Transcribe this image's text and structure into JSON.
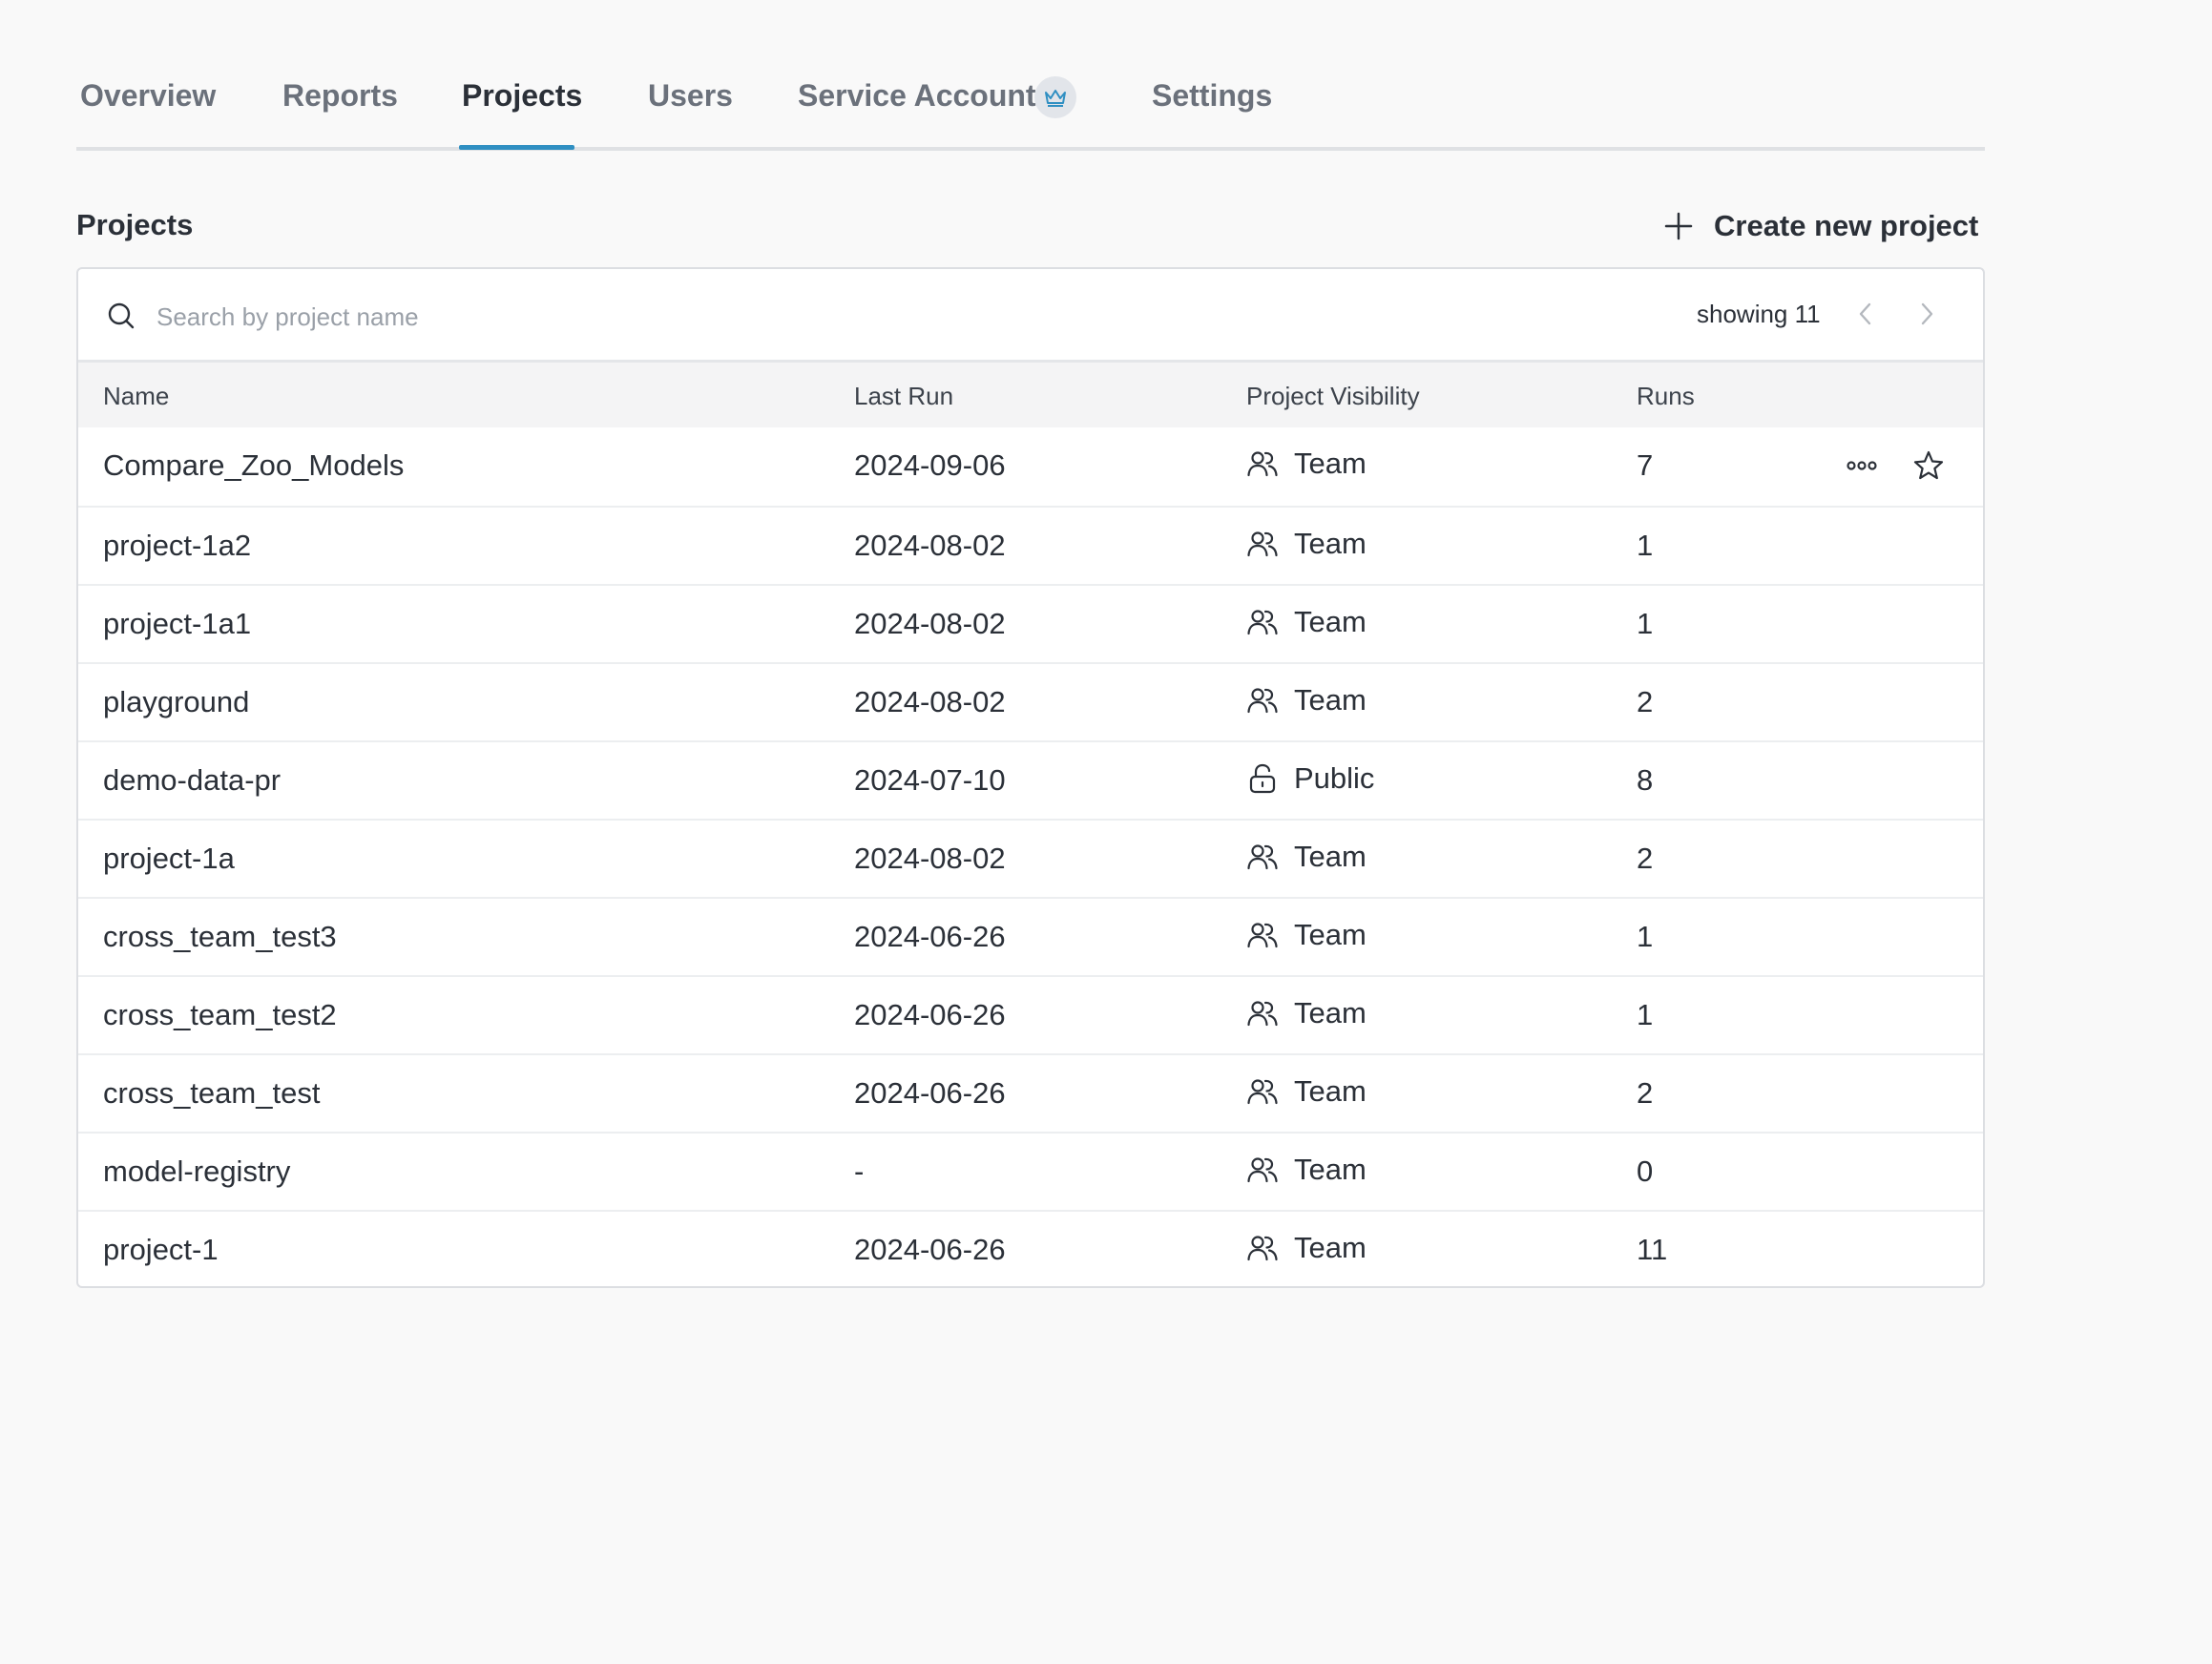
{
  "tabs": [
    {
      "label": "Overview"
    },
    {
      "label": "Reports"
    },
    {
      "label": "Projects",
      "active": true
    },
    {
      "label": "Users"
    },
    {
      "label": "Service Accounts",
      "icon": "crown-icon"
    },
    {
      "label": "Settings"
    }
  ],
  "section": {
    "title": "Projects",
    "create_label": "Create new project"
  },
  "search": {
    "placeholder": "Search by project name",
    "value": "",
    "showing_text": "showing 11"
  },
  "table": {
    "columns": [
      "Name",
      "Last Run",
      "Project Visibility",
      "Runs"
    ],
    "rows": [
      {
        "name": "Compare_Zoo_Models",
        "last_run": "2024-09-06",
        "visibility": "Team",
        "visibility_icon": "team-icon",
        "runs": "7"
      },
      {
        "name": "project-1a2",
        "last_run": "2024-08-02",
        "visibility": "Team",
        "visibility_icon": "team-icon",
        "runs": "1"
      },
      {
        "name": "project-1a1",
        "last_run": "2024-08-02",
        "visibility": "Team",
        "visibility_icon": "team-icon",
        "runs": "1"
      },
      {
        "name": "playground",
        "last_run": "2024-08-02",
        "visibility": "Team",
        "visibility_icon": "team-icon",
        "runs": "2"
      },
      {
        "name": "demo-data-pr",
        "last_run": "2024-07-10",
        "visibility": "Public",
        "visibility_icon": "unlock-icon",
        "runs": "8"
      },
      {
        "name": "project-1a",
        "last_run": "2024-08-02",
        "visibility": "Team",
        "visibility_icon": "team-icon",
        "runs": "2"
      },
      {
        "name": "cross_team_test3",
        "last_run": "2024-06-26",
        "visibility": "Team",
        "visibility_icon": "team-icon",
        "runs": "1"
      },
      {
        "name": "cross_team_test2",
        "last_run": "2024-06-26",
        "visibility": "Team",
        "visibility_icon": "team-icon",
        "runs": "1"
      },
      {
        "name": "cross_team_test",
        "last_run": "2024-06-26",
        "visibility": "Team",
        "visibility_icon": "team-icon",
        "runs": "2"
      },
      {
        "name": "model-registry",
        "last_run": "-",
        "visibility": "Team",
        "visibility_icon": "team-icon",
        "runs": "0"
      },
      {
        "name": "project-1",
        "last_run": "2024-06-26",
        "visibility": "Team",
        "visibility_icon": "team-icon",
        "runs": "11"
      }
    ]
  },
  "colors": {
    "accent": "#2f8fc2",
    "background": "#f9f9f9",
    "text": "#2b3038",
    "muted_text": "#6b717b"
  }
}
